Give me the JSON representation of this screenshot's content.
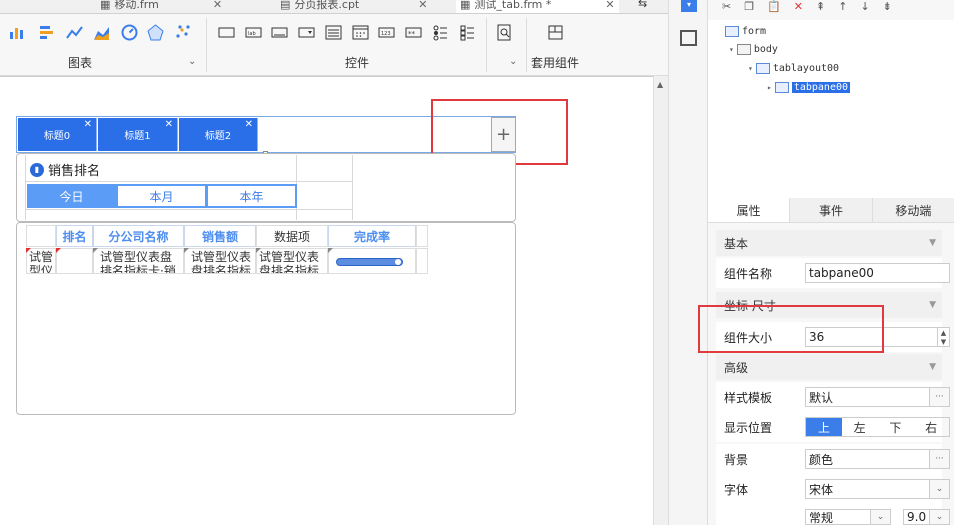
{
  "file_tabs": [
    {
      "label": "移动.frm",
      "active": false
    },
    {
      "label": "分页报表.cpt",
      "active": false
    },
    {
      "label": "测试_tab.frm *",
      "active": true
    }
  ],
  "ribbon": {
    "groups": [
      {
        "label": "图表"
      },
      {
        "label": "控件"
      },
      {
        "label": "套用组件"
      }
    ]
  },
  "tab_layout": {
    "tabs": [
      {
        "label": "标题0"
      },
      {
        "label": "标题1"
      },
      {
        "label": "标题2"
      }
    ],
    "add_symbol": "+"
  },
  "rank_block": {
    "title": "销售排名",
    "segments": [
      {
        "label": "今日",
        "selected": true
      },
      {
        "label": "本月",
        "selected": false
      },
      {
        "label": "本年",
        "selected": false
      }
    ]
  },
  "table": {
    "headers": [
      "排名",
      "分公司名称",
      "销售额",
      "数据项",
      "完成率"
    ],
    "row": [
      "试管型仪",
      "",
      "试管型仪表盘排名指标卡·销",
      "试管型仪表盘排名指标",
      "试管型仪表盘排名指标"
    ],
    "progress": 0.95
  },
  "tree": {
    "nodes": [
      {
        "label": "form"
      },
      {
        "label": "body"
      },
      {
        "label": "tablayout00"
      },
      {
        "label": "tabpane00"
      }
    ]
  },
  "panel_tabs": [
    {
      "label": "属性",
      "active": true
    },
    {
      "label": "事件",
      "active": false
    },
    {
      "label": "移动端",
      "active": false
    }
  ],
  "sections": {
    "basic": "基本",
    "coords": "坐标 尺寸",
    "advanced": "高级"
  },
  "props": {
    "component_name_label": "组件名称",
    "component_name_value": "tabpane00",
    "size_label": "组件大小",
    "size_value": "36",
    "style_label": "样式模板",
    "style_value": "默认",
    "position_label": "显示位置",
    "positions": [
      {
        "label": "上",
        "selected": true
      },
      {
        "label": "左",
        "selected": false
      },
      {
        "label": "下",
        "selected": false
      },
      {
        "label": "右",
        "selected": false
      }
    ],
    "bg_label": "背景",
    "bg_value": "颜色",
    "font_label": "字体",
    "font_value": "宋体",
    "font_style_value": "常规",
    "font_size_value": "9.0"
  },
  "colors": {
    "accent": "#2a6fe8",
    "highlight_box": "#e0393e",
    "header_text": "#4d8ef0"
  }
}
